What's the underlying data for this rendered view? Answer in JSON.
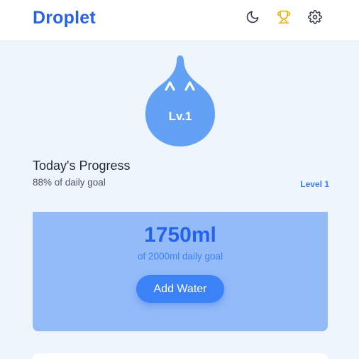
{
  "app": {
    "title": "Droplet"
  },
  "header": {
    "icons": [
      "moon-icon",
      "trophy-icon",
      "gear-icon"
    ]
  },
  "mascot": {
    "eyes": "^ ^",
    "level_label": "Lv.1"
  },
  "progress": {
    "title": "Today's Progress",
    "subtitle": "88% of daily goal",
    "percent": 88,
    "level_label": "Level 1"
  },
  "water": {
    "amount": "1750ml",
    "goal_text": "of 2000ml daily goal",
    "add_label": "Add Water"
  },
  "colors": {
    "brand": "#2563eb",
    "accent": "#3b82f6",
    "drop": "#62a1f4",
    "card": "#93bbf8",
    "trophy": "#eab308",
    "background": "#eff5fd"
  }
}
